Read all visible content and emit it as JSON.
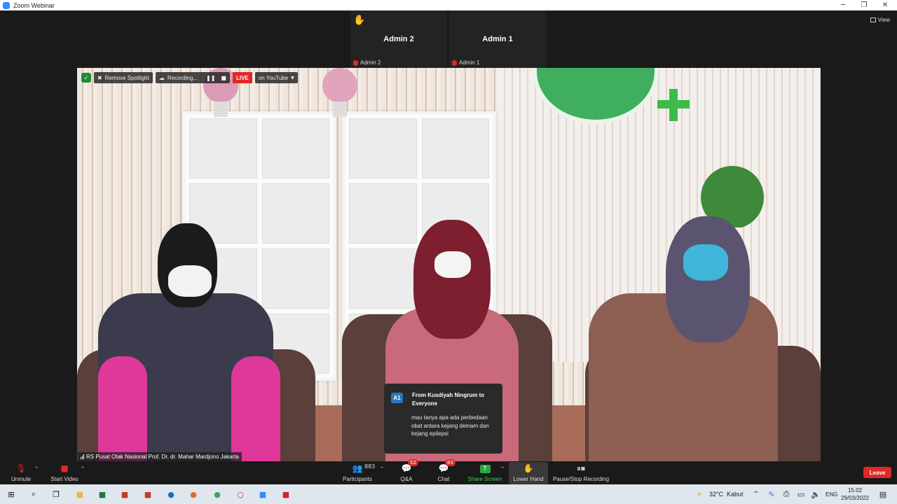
{
  "window": {
    "title": "Zoom Webinar",
    "controls": {
      "minimize": "─",
      "restore": "❐",
      "close": "✕"
    }
  },
  "raised_hand_icon": "✋",
  "view_label": "View",
  "thumbnails": [
    {
      "name": "Admin 2",
      "sub": "Admin 2"
    },
    {
      "name": "Admin 1",
      "sub": "Admin 1"
    }
  ],
  "video_toolbar": {
    "remove_spotlight": "Remove Spotlight",
    "recording": "Recording...",
    "pause_glyph": "❚❚",
    "stop_glyph": "■",
    "live": "LIVE",
    "on_youtube": "on YouTube"
  },
  "speaker_name": "RS Pusat Otak Nasional Prof. Dr. dr. Mahar Mardjono Jakarta",
  "chat_popup": {
    "avatar": "A1",
    "from": "From Kusdiyah Ningrum to Everyone",
    "message": "mau tanya apa ada perbedaan obat antara kejang demam dan kejang epilepsi"
  },
  "controls": {
    "unmute": "Unmute",
    "start_video": "Start Video",
    "participants": "Participants",
    "participants_count": "883",
    "qa": "Q&A",
    "qa_badge": "52",
    "chat": "Chat",
    "chat_badge": "83",
    "share_screen": "Share Screen",
    "lower_hand": "Lower Hand",
    "pause_stop_recording": "Pause/Stop Recording",
    "leave": "Leave"
  },
  "taskbar": {
    "weather_temp": "32°C",
    "weather_desc": "Kabut",
    "language": "ENG",
    "time": "15.02",
    "date": "29/03/2022"
  },
  "colors": {
    "zoom_blue": "#2d8cff",
    "live_red": "#e02828",
    "share_green": "#28a745",
    "leave_red": "#e02828"
  }
}
